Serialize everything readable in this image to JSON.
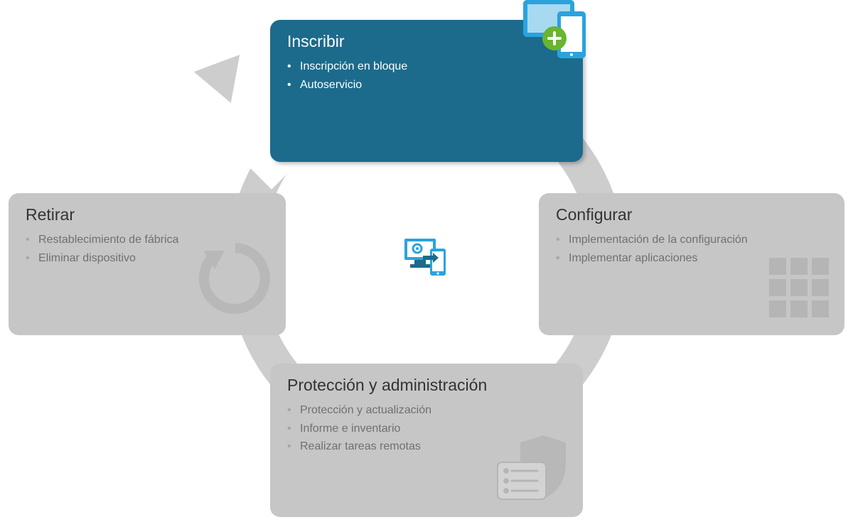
{
  "cycle": {
    "enroll": {
      "title": "Inscribir",
      "items": [
        "Inscripción en bloque",
        "Autoservicio"
      ]
    },
    "configure": {
      "title": "Configurar",
      "items": [
        "Implementación de la configuración",
        "Implementar aplicaciones"
      ]
    },
    "protect": {
      "title": "Protección y administración",
      "items": [
        "Protección y actualización",
        "Informe e inventario",
        "Realizar tareas remotas"
      ]
    },
    "retire": {
      "title": "Retirar",
      "items": [
        "Restablecimiento de fábrica",
        "Eliminar dispositivo"
      ]
    }
  }
}
